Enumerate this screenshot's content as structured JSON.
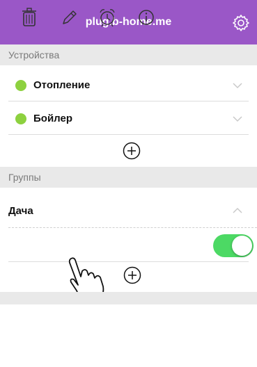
{
  "header": {
    "title": "plug.b-home.me",
    "settings_icon": "gear-icon"
  },
  "devices": {
    "section_title": "Устройства",
    "items": [
      {
        "label": "Отопление",
        "status_color": "#8dd13f",
        "expanded": false
      },
      {
        "label": "Бойлер",
        "status_color": "#8dd13f",
        "expanded": false
      }
    ],
    "add_icon": "plus-circle-icon"
  },
  "groups": {
    "section_title": "Группы",
    "items": [
      {
        "label": "Дача",
        "expanded": true,
        "actions": [
          "trash-icon",
          "pencil-icon",
          "alarm-clock-icon",
          "info-icon"
        ],
        "toggle_on": true
      }
    ],
    "add_icon": "plus-circle-icon"
  },
  "colors": {
    "accent": "#9a57c7",
    "toggle_on": "#4cd964",
    "status": "#8dd13f"
  }
}
